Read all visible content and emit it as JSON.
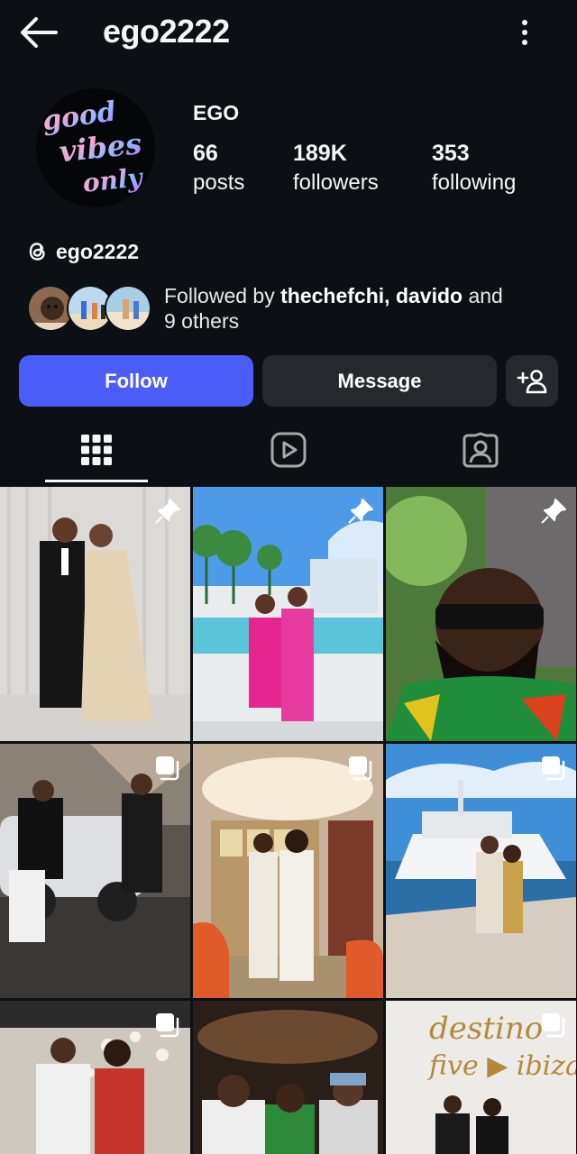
{
  "header": {
    "username": "ego2222",
    "back_icon": "arrow-left-icon",
    "more_icon": "more-vertical-icon"
  },
  "profile": {
    "display_name": "EGO",
    "avatar_text": [
      "good",
      "vibes",
      "only"
    ],
    "stats": {
      "posts": {
        "value": "66",
        "label": "posts"
      },
      "followers": {
        "value": "189K",
        "label": "followers"
      },
      "following": {
        "value": "353",
        "label": "following"
      }
    },
    "threads_handle": "ego2222",
    "followed_by": {
      "prefix": "Followed by ",
      "users": [
        "thechefchi",
        "davido"
      ],
      "separator": ", ",
      "suffix": " and",
      "others": "9 others"
    }
  },
  "actions": {
    "follow_label": "Follow",
    "message_label": "Message",
    "add_user_icon": "add-person-icon"
  },
  "tabs": [
    {
      "name": "grid",
      "icon": "grid-icon",
      "active": true
    },
    {
      "name": "reels",
      "icon": "reels-icon",
      "active": false
    },
    {
      "name": "tagged",
      "icon": "tagged-user-icon",
      "active": false
    }
  ],
  "posts": [
    {
      "badge": "pin-icon"
    },
    {
      "badge": "pin-icon"
    },
    {
      "badge": "pin-icon"
    },
    {
      "badge": "carousel-icon"
    },
    {
      "badge": "carousel-icon"
    },
    {
      "badge": "carousel-icon"
    },
    {
      "badge": "carousel-icon",
      "image_text": ""
    },
    {
      "badge": "",
      "image_text": ""
    },
    {
      "badge": "carousel-icon",
      "image_text": "destino five ▶ ibiza"
    }
  ],
  "colors": {
    "background": "#0c1014",
    "follow_button": "#4a5df9",
    "secondary_button": "#25292e",
    "text": "#f5f5f5"
  }
}
